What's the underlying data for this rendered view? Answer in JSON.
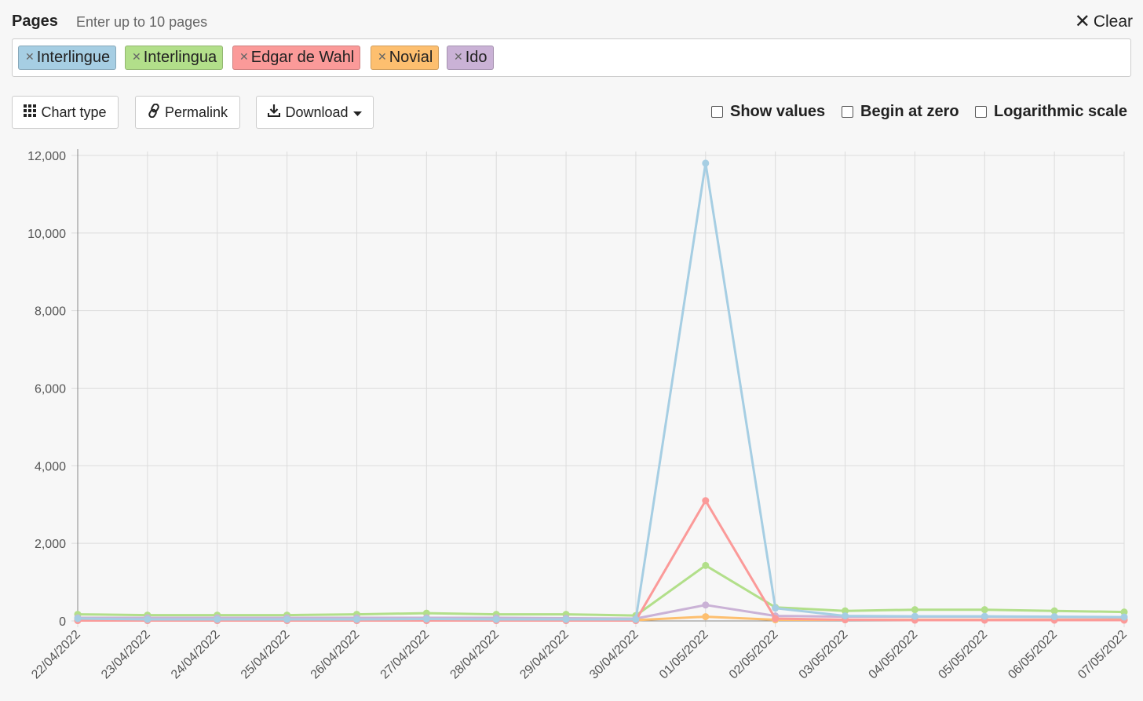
{
  "header": {
    "title": "Pages",
    "hint": "Enter up to 10 pages",
    "clear_label": "Clear"
  },
  "tags": [
    {
      "label": "Interlingue",
      "color": "#a6cee3"
    },
    {
      "label": "Interlingua",
      "color": "#b2df8a"
    },
    {
      "label": "Edgar de Wahl",
      "color": "#fb9a99"
    },
    {
      "label": "Novial",
      "color": "#fdbf6f"
    },
    {
      "label": "Ido",
      "color": "#cab2d6"
    }
  ],
  "toolbar": {
    "chart_type_label": "Chart type",
    "permalink_label": "Permalink",
    "download_label": "Download"
  },
  "options": {
    "show_values": "Show values",
    "begin_at_zero": "Begin at zero",
    "log_scale": "Logarithmic scale"
  },
  "chart_data": {
    "type": "line",
    "categories": [
      "22/04/2022",
      "23/04/2022",
      "24/04/2022",
      "25/04/2022",
      "26/04/2022",
      "27/04/2022",
      "28/04/2022",
      "29/04/2022",
      "30/04/2022",
      "01/05/2022",
      "02/05/2022",
      "03/05/2022",
      "04/05/2022",
      "05/05/2022",
      "06/05/2022",
      "07/05/2022"
    ],
    "ylim": [
      0,
      12000
    ],
    "yticks": [
      0,
      2000,
      4000,
      6000,
      8000,
      10000,
      12000
    ],
    "ytick_labels": [
      "0",
      "2,000",
      "4,000",
      "6,000",
      "8,000",
      "10,000",
      "12,000"
    ],
    "grid": true,
    "series": [
      {
        "name": "Interlingua",
        "color": "#b2df8a",
        "values": [
          170,
          150,
          150,
          150,
          170,
          200,
          170,
          170,
          140,
          1430,
          350,
          260,
          290,
          290,
          260,
          230
        ]
      },
      {
        "name": "Ido",
        "color": "#cab2d6",
        "values": [
          80,
          80,
          80,
          80,
          80,
          80,
          80,
          70,
          60,
          410,
          130,
          110,
          110,
          110,
          100,
          90
        ]
      },
      {
        "name": "Novial",
        "color": "#fdbf6f",
        "values": [
          20,
          20,
          20,
          20,
          20,
          20,
          20,
          20,
          20,
          110,
          30,
          30,
          30,
          30,
          30,
          30
        ]
      },
      {
        "name": "Edgar de Wahl",
        "color": "#fb9a99",
        "values": [
          10,
          10,
          10,
          10,
          10,
          10,
          10,
          10,
          10,
          3100,
          60,
          30,
          20,
          20,
          20,
          20
        ]
      },
      {
        "name": "Interlingue",
        "color": "#a6cee3",
        "values": [
          60,
          40,
          40,
          40,
          40,
          50,
          40,
          40,
          40,
          11800,
          330,
          130,
          120,
          120,
          110,
          100
        ]
      }
    ]
  }
}
